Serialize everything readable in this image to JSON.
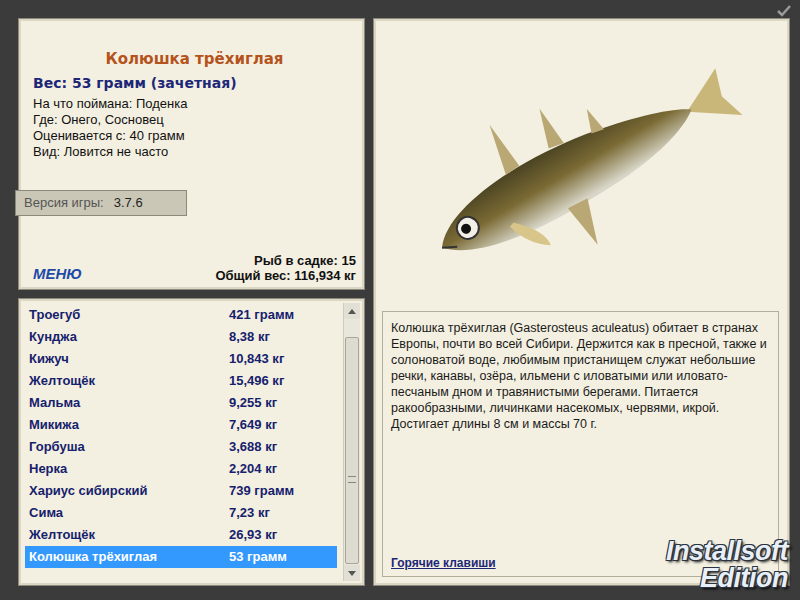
{
  "fish": {
    "title": "Колюшка трёхиглая",
    "weight": "Вес: 53 грамм (зачетная)",
    "details": [
      "На что поймана: Поденка",
      "Где: Онего, Сосновец",
      "Оценивается с: 40 грамм",
      "Вид: Ловится не часто"
    ]
  },
  "version": {
    "label": "Версия игры:",
    "value": "3.7.6"
  },
  "menu": "МЕНЮ",
  "totals": [
    "Рыб в садке: 15",
    "Общий вес: 116,934 кг"
  ],
  "catch_list": {
    "rows": [
      {
        "name": "Троегуб",
        "weight": "421 грамм",
        "selected": false
      },
      {
        "name": "Кунджа",
        "weight": "8,38 кг",
        "selected": false
      },
      {
        "name": "Кижуч",
        "weight": "10,843 кг",
        "selected": false
      },
      {
        "name": "Желтощёк",
        "weight": "15,496 кг",
        "selected": false
      },
      {
        "name": "Мальма",
        "weight": "9,255 кг",
        "selected": false
      },
      {
        "name": "Микижа",
        "weight": "7,649 кг",
        "selected": false
      },
      {
        "name": "Горбуша",
        "weight": "3,688 кг",
        "selected": false
      },
      {
        "name": "Нерка",
        "weight": "2,204 кг",
        "selected": false
      },
      {
        "name": "Хариус сибирский",
        "weight": "739 грамм",
        "selected": false
      },
      {
        "name": "Сима",
        "weight": "7,23 кг",
        "selected": false
      },
      {
        "name": "Желтощёк",
        "weight": "26,93 кг",
        "selected": false
      },
      {
        "name": "Колюшка трёхиглая",
        "weight": "53 грамм",
        "selected": true
      }
    ],
    "scrollbar": {
      "level": 0.93
    }
  },
  "description": "Колюшка трёхиглая (Gasterosteus aculeatus) обитает в странах Европы, почти во всей Сибири. Держится как в пресной, также и солоноватой воде, любимым пристанищем служат небольшие речки, канавы, озёра, ильмени с иловатыми или иловато-песчаным дном и травянистыми берегами. Питается ракообразными, личинками насекомых, червями, икрой. Достигает длины 8 см и массы 70 г.",
  "hotkeys": "Горячие клавиши",
  "logo": [
    "Installsoft",
    "Edition"
  ]
}
